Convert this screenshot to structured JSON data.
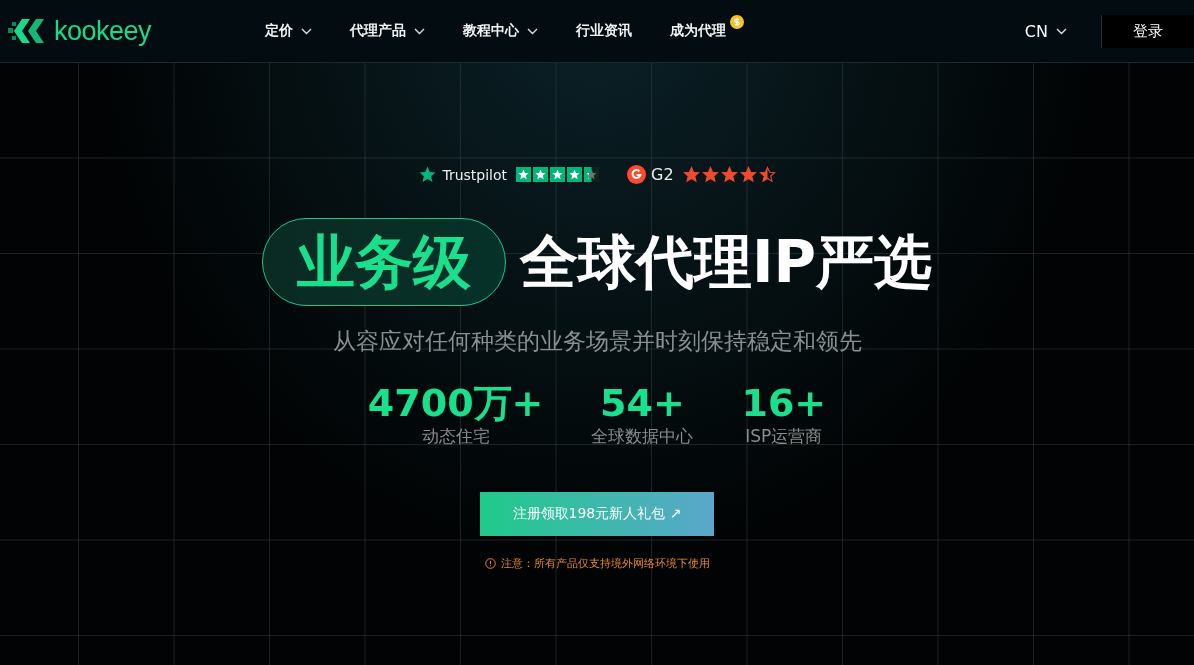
{
  "brand": {
    "name": "kookeey"
  },
  "nav": [
    {
      "label": "定价",
      "has_menu": true,
      "coin": false
    },
    {
      "label": "代理产品",
      "has_menu": true,
      "coin": false
    },
    {
      "label": "教程中心",
      "has_menu": true,
      "coin": false
    },
    {
      "label": "行业资讯",
      "has_menu": false,
      "coin": false
    },
    {
      "label": "成为代理",
      "has_menu": false,
      "coin": true
    }
  ],
  "language": {
    "label": "CN"
  },
  "login": {
    "label": "登录"
  },
  "ratings": [
    {
      "kind": "trustpilot",
      "name": "Trustpilot",
      "stars": 4.5
    },
    {
      "kind": "g2",
      "name": "G2",
      "stars": 4.5
    }
  ],
  "hero": {
    "pill": "业务级",
    "title": "全球代理IP严选",
    "subtitle": "从容应对任何种类的业务场景并时刻保持稳定和领先"
  },
  "stats": [
    {
      "value": "4700万+",
      "label": "动态住宅"
    },
    {
      "value": "54+",
      "label": "全球数据中心"
    },
    {
      "value": "16+",
      "label": "ISP运营商"
    }
  ],
  "cta": {
    "label": "注册领取198元新人礼包",
    "arrow": "↗"
  },
  "notice": "注意：所有产品仅支持境外网络环境下使用"
}
